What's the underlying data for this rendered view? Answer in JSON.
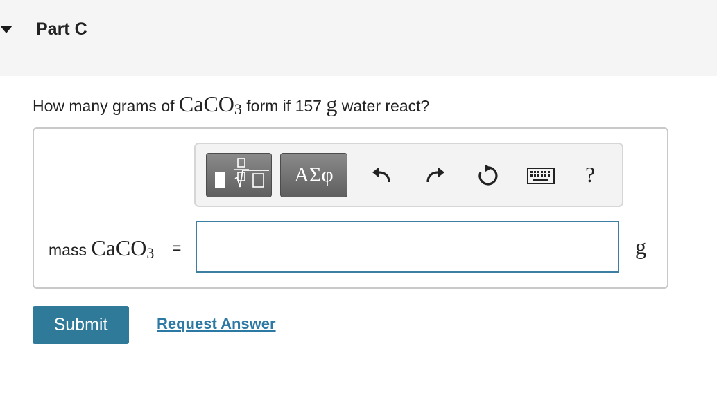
{
  "header": {
    "part_title": "Part C"
  },
  "question": {
    "prefix": "How many grams of ",
    "formula_base": "CaCO",
    "formula_sub": "3",
    "middle": " form if 157 ",
    "unit": "g",
    "suffix": " water react?"
  },
  "toolbar": {
    "templates_icon": "fraction-sqrt-template-icon",
    "greek_label": "ΑΣφ",
    "undo_icon": "undo-icon",
    "redo_icon": "redo-icon",
    "reset_icon": "reset-icon",
    "keyboard_icon": "keyboard-icon",
    "help_label": "?"
  },
  "answer": {
    "label_text": "mass ",
    "label_formula_base": "CaCO",
    "label_formula_sub": "3",
    "equals": "=",
    "value": "",
    "unit": "g"
  },
  "actions": {
    "submit_label": "Submit",
    "request_label": "Request Answer"
  },
  "colors": {
    "accent": "#2f7a99",
    "link": "#2c7aa3",
    "input_border": "#3d7fa3"
  }
}
